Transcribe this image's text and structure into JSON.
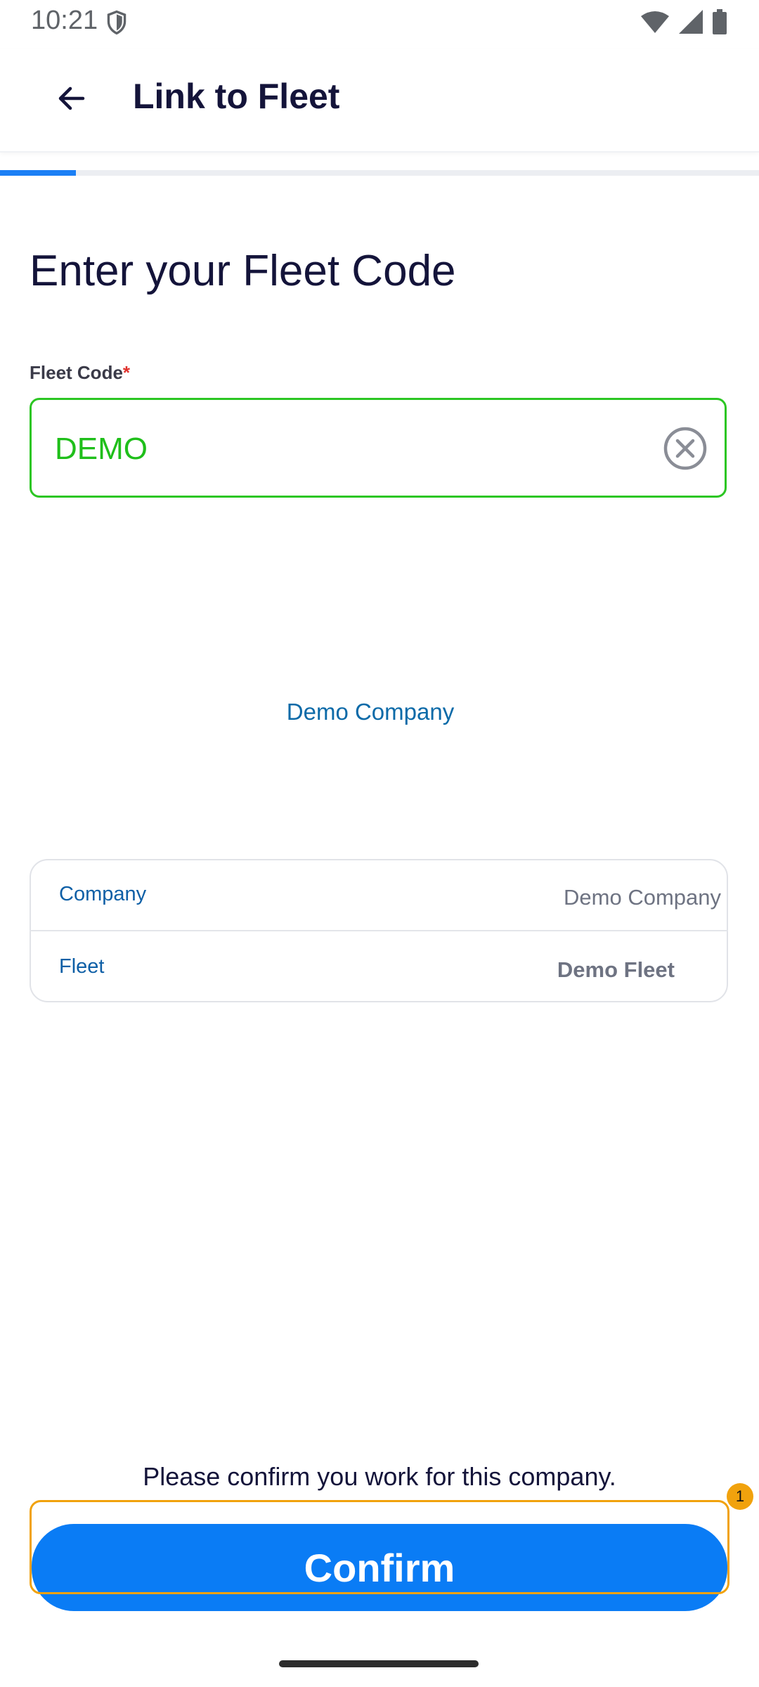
{
  "status_bar": {
    "time": "10:21"
  },
  "app_bar": {
    "title": "Link to Fleet"
  },
  "progress": {
    "fraction": 0.1
  },
  "page": {
    "heading": "Enter your Fleet Code"
  },
  "fleet_code_field": {
    "label": "Fleet Code",
    "required_mark": "*",
    "value": "DEMO"
  },
  "company_center_label": "Demo Company",
  "details": {
    "company_label": "Company",
    "company_value": "Demo Company",
    "fleet_label": "Fleet",
    "fleet_value": "Demo Fleet"
  },
  "footer": {
    "confirm_prompt": "Please confirm you work for this company.",
    "confirm_label": "Confirm",
    "badge_count": "1"
  },
  "colors": {
    "accent": "#0a7cf5",
    "success": "#2cc623",
    "highlight": "#f1a20d"
  }
}
